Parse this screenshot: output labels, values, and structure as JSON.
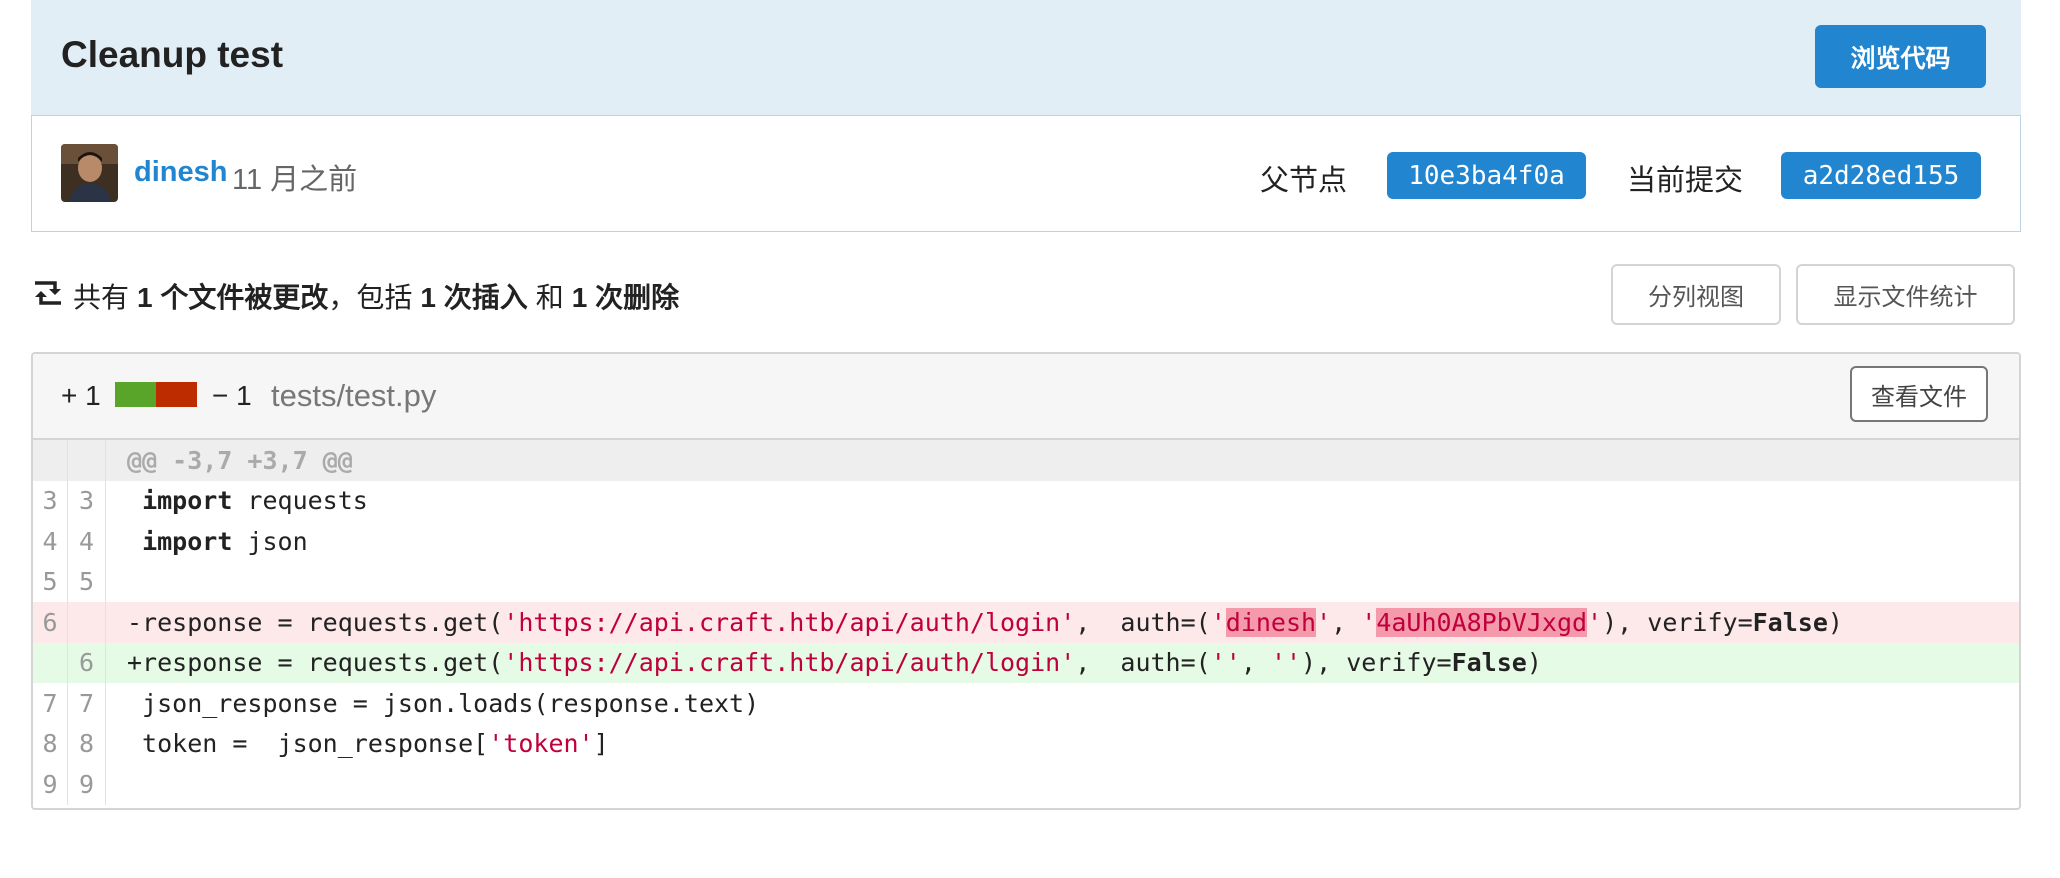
{
  "commit": {
    "title": "Cleanup test",
    "browse_label": "浏览代码",
    "author": "dinesh",
    "time": "11 月之前",
    "parent_label": "父节点",
    "parent_sha": "10e3ba4f0a",
    "current_label": "当前提交",
    "current_sha": "a2d28ed155"
  },
  "stats": {
    "p1": "共有",
    "files": "1 个文件被更改",
    "p2": "，包括",
    "insertions": "1 次插入",
    "p3": "和",
    "deletions": "1 次删除",
    "split_view_label": "分列视图",
    "show_stats_label": "显示文件统计"
  },
  "file": {
    "additions": "+ 1",
    "deletions": "− 1",
    "name": "tests/test.py",
    "view_file_label": "查看文件"
  },
  "diff": {
    "hunk": "@@ -3,7 +3,7 @@",
    "rows": [
      {
        "old": "3",
        "new": "3"
      },
      {
        "old": "4",
        "new": "4"
      },
      {
        "old": "5",
        "new": "5"
      },
      {
        "old": "6",
        "new": ""
      },
      {
        "old": "",
        "new": "6"
      },
      {
        "old": "7",
        "new": "7"
      },
      {
        "old": "8",
        "new": "8"
      },
      {
        "old": "9",
        "new": "9"
      }
    ],
    "t": {
      "import": "import",
      "requests": " requests",
      "json": " json",
      "del_prefix": "-response = requests.get(",
      "add_prefix": "+response = requests.get(",
      "url": "'https://api.craft.htb/api/auth/login'",
      "auth_open": ",  auth=(",
      "q": "'",
      "user": "dinesh",
      "comma": ", ",
      "pass": "4aUh0A8PbVJxgd",
      "verify": "), verify=",
      "false": "False",
      "close": ")",
      "empty_pair1": "''",
      "empty_pair2": "''",
      "line7": " json_response = json.loads(response.text)",
      "line8a": " token =  json_response[",
      "line8s": "'token'",
      "line8b": "]"
    }
  },
  "colors": {
    "primary": "#2185d0",
    "header_bg": "#e1eef6",
    "add_bar": "#58a52a",
    "del_bar": "#bd2c00",
    "del_bg": "#fde8ea",
    "add_bg": "#e6fbe6",
    "string": "#c0003d"
  }
}
